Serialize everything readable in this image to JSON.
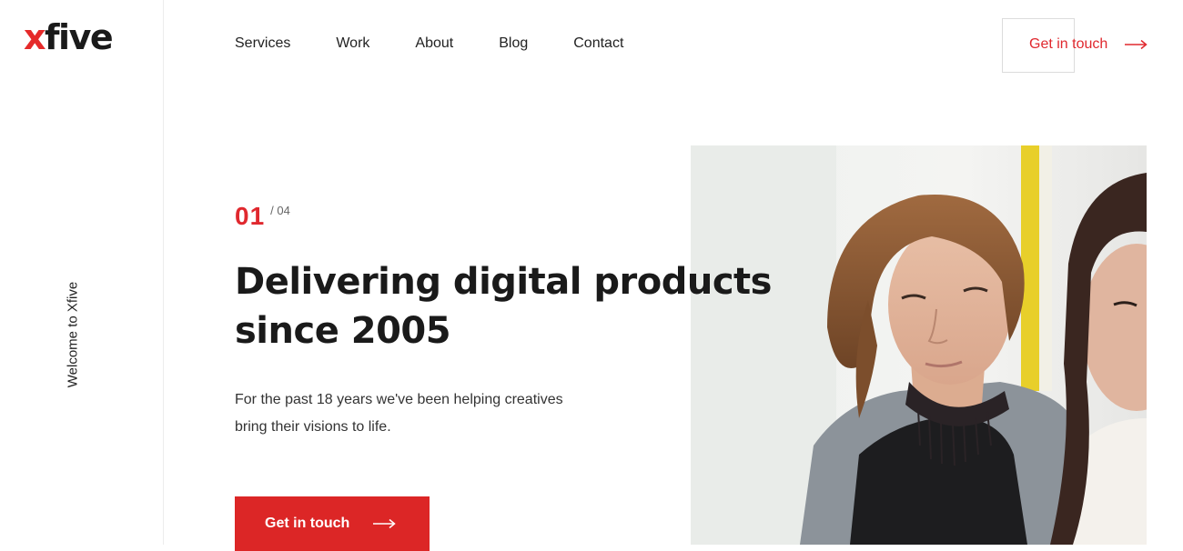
{
  "logo": {
    "x": "x",
    "rest": "five"
  },
  "sidebar": {
    "vertical_text": "Welcome to Xfive"
  },
  "nav": {
    "items": [
      "Services",
      "Work",
      "About",
      "Blog",
      "Contact"
    ]
  },
  "header_cta": {
    "label": "Get in touch",
    "icon": "arrow-right-icon"
  },
  "hero": {
    "counter_current": "01",
    "counter_total": "/ 04",
    "headline": "Delivering digital products since 2005",
    "subtext": "For the past 18 years we've been helping creatives bring their visions to life.",
    "cta_label": "Get in touch",
    "image_alt": "Two women looking at a screen"
  },
  "colors": {
    "accent": "#e0282e",
    "button_bg": "#dc2626",
    "text": "#1a1a1a",
    "hair": "#8a5a36",
    "yellow_bar": "#f0d020"
  }
}
